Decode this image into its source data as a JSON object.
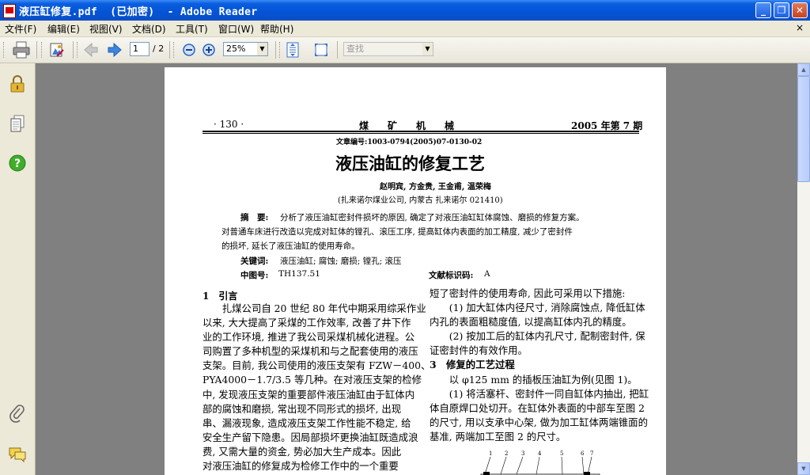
{
  "window": {
    "title": "液压缸修复.pdf  (已加密)  - Adobe Reader",
    "buttons": {
      "minimize": "_",
      "restore": "❐",
      "close": "✕"
    }
  },
  "menu": {
    "items": [
      "文件(F)",
      "编辑(E)",
      "视图(V)",
      "文档(D)",
      "工具(T)",
      "窗口(W)",
      "帮助(H)"
    ],
    "close_document": "×"
  },
  "toolbar": {
    "page_current": "1",
    "page_total": "/ 2",
    "zoom": "25%",
    "search_placeholder": "查找",
    "icons": [
      "printer-icon",
      "layout-icon",
      "previous-page-icon",
      "next-page-icon",
      "zoom-out-icon",
      "zoom-in-icon",
      "fit-page-icon",
      "actual-size-icon"
    ]
  },
  "nav_pane": {
    "icons": [
      "security-lock-icon",
      "pages-icon",
      "help-icon",
      "attachments-paperclip-icon",
      "comments-icon"
    ]
  },
  "document": {
    "page_number": "· 130 ·",
    "journal_name": "煤　　矿　　机　　械",
    "issue": "2005 年第 7 期",
    "article_id": "文章编号:1003-0794(2005)07-0130-02",
    "title": "液压油缸的修复工艺",
    "authors": "赵明宾, 方金贵, 王金甫, 温荣梅",
    "affiliation": "(扎来诺尔煤业公司, 内蒙古 扎来诺尔 021410)",
    "abstract_label": "摘　要:",
    "abstract_lines": [
      "分析了液压油缸密封件损坏的原因, 确定了对液压油缸缸体腐蚀、磨损的修复方案。",
      "对普通车床进行改造以完成对缸体的镗孔、滚压工序, 提高缸体内表面的加工精度, 减少了密封件",
      "的损坏, 延长了液压油缸的使用寿命。"
    ],
    "keywords_label": "关键词:",
    "keywords": "液压油缸; 腐蚀; 磨损; 镗孔; 滚压",
    "clc_label": "中图号:",
    "clc": "TH137.51",
    "doc_code_label": "文献标识码:",
    "doc_code": "A",
    "section1_heading": "1　引言",
    "left_col_lines": [
      "　　扎煤公司自 20 世纪 80 年代中期采用综采作业",
      "以来, 大大提高了采煤的工作效率, 改善了井下作",
      "业的工作环境, 推进了我公司采煤机械化进程。公",
      "司购置了多种机型的采煤机和与之配套使用的液压",
      "支架。目前, 我公司使用的液压支架有 FZW－400、",
      "PYA4000－1.7/3.5 等几种。在对液压支架的检修",
      "中, 发现液压支架的重要部件液压油缸由于缸体内",
      "部的腐蚀和磨损, 常出现不同形式的损坏, 出现",
      "串、漏液现象, 造成液压支架工作性能不稳定, 给",
      "安全生产留下隐患。因局部损坏更换油缸既造成浪",
      "费, 又需大量的资金, 势必加大生产成本。因此",
      "对液压油缸的修复成为检修工作中的一个重要"
    ],
    "right_col_lines": [
      "短了密封件的使用寿命, 因此可采用以下措施:",
      "　　(1) 加大缸体内径尺寸, 消除腐蚀点, 降低缸体",
      "内孔的表面粗糙度值, 以提高缸体内孔的精度。",
      "　　(2) 按加工后的缸体内孔尺寸, 配制密封件, 保",
      "证密封件的有效作用。"
    ],
    "section3_heading": "3　修复的工艺过程",
    "right_col_lines_2": [
      "　　以 φ125 mm 的插板压油缸为例(见图 1)。",
      "　　(1) 将活塞杆、密封件一同自缸体内抽出, 把缸",
      "体自原焊口处切开。在缸体外表面的中部车至图 2",
      "的尺寸, 用以支承中心架, 做为加工缸体两端锥面的",
      "基准, 两端加工至图 2 的尺寸。"
    ],
    "figure_labels": [
      "1",
      "2",
      "3",
      "4",
      "5",
      "6",
      "7"
    ]
  }
}
